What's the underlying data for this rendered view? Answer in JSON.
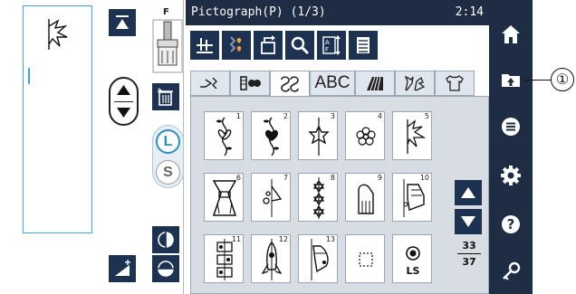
{
  "header": {
    "title": "Pictograph(P) (1/3)",
    "clock": "2:14"
  },
  "left_panel": {
    "presser_foot_label": "F",
    "size_l": "L",
    "size_s": "S"
  },
  "tabs": [
    {
      "name": "tab-utility",
      "icon": "utility-stitch-icon",
      "active": false
    },
    {
      "name": "tab-satin",
      "icon": "satin-stitch-icon",
      "active": false
    },
    {
      "name": "tab-decorative",
      "icon": "decorative-stitch-icon",
      "active": true
    },
    {
      "name": "tab-abc",
      "label": "ABC",
      "active": false
    },
    {
      "name": "tab-cross",
      "icon": "cross-stitch-icon",
      "active": false
    },
    {
      "name": "tab-floral",
      "icon": "floral-icon",
      "active": false
    },
    {
      "name": "tab-shirt",
      "icon": "shirt-icon",
      "active": false
    }
  ],
  "patterns": [
    {
      "number": "1"
    },
    {
      "number": "2"
    },
    {
      "number": "3"
    },
    {
      "number": "4"
    },
    {
      "number": "5"
    },
    {
      "number": "6"
    },
    {
      "number": "7"
    },
    {
      "number": "8"
    },
    {
      "number": "9"
    },
    {
      "number": "10"
    },
    {
      "number": "11"
    },
    {
      "number": "12"
    },
    {
      "number": "13"
    },
    {
      "number": ""
    },
    {
      "number": ""
    }
  ],
  "pattern_extras": {
    "ls_label": "LS"
  },
  "pagination": {
    "current": "33",
    "total": "37"
  },
  "callout": {
    "label": "①"
  },
  "colors": {
    "dark_navy": "#1e2c44",
    "button_navy": "#1d3150",
    "accent_blue": "#2c8dc1",
    "heart_amber": "#e8a33a"
  }
}
